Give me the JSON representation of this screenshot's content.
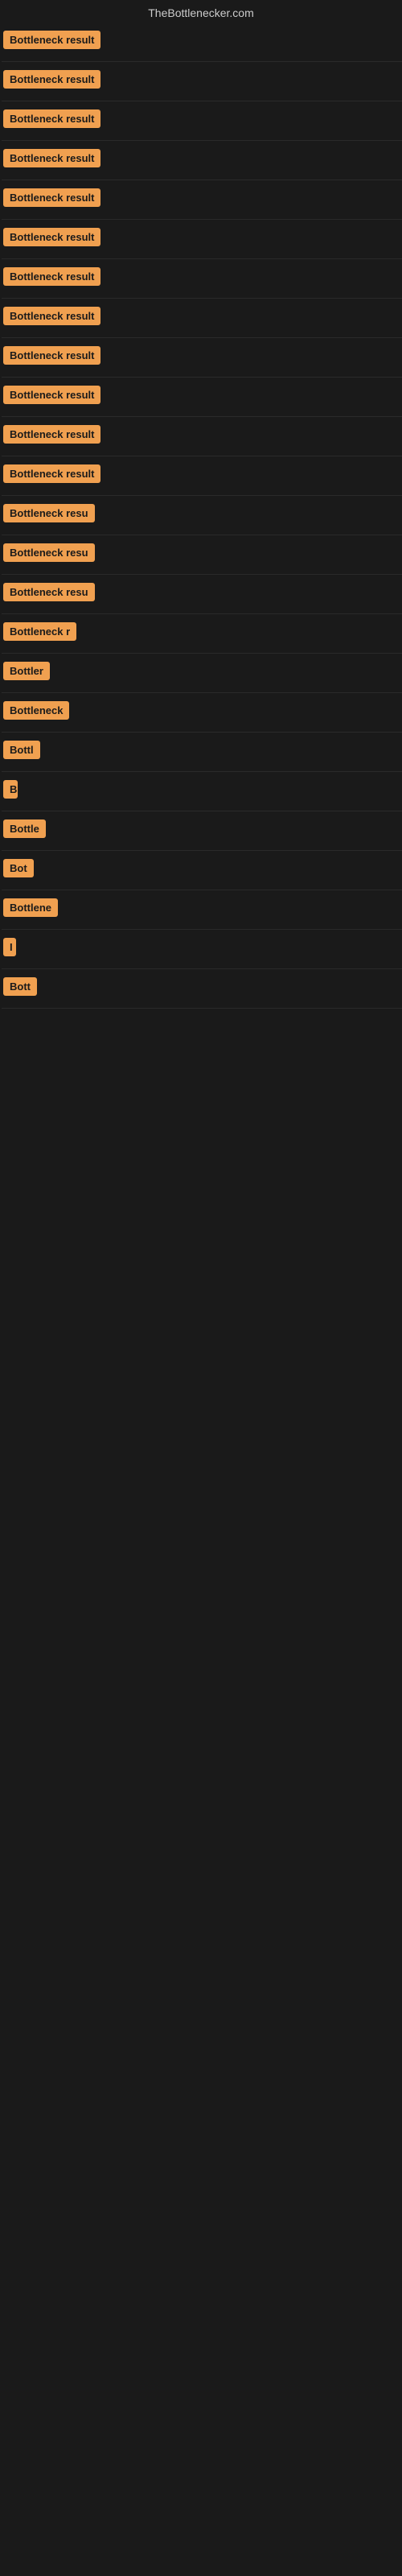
{
  "site": {
    "title": "TheBottlenecker.com"
  },
  "rows": [
    {
      "label": "Bottleneck result",
      "width": 155
    },
    {
      "label": "Bottleneck result",
      "width": 155
    },
    {
      "label": "Bottleneck result",
      "width": 155
    },
    {
      "label": "Bottleneck result",
      "width": 155
    },
    {
      "label": "Bottleneck result",
      "width": 155
    },
    {
      "label": "Bottleneck result",
      "width": 155
    },
    {
      "label": "Bottleneck result",
      "width": 155
    },
    {
      "label": "Bottleneck result",
      "width": 155
    },
    {
      "label": "Bottleneck result",
      "width": 152
    },
    {
      "label": "Bottleneck result",
      "width": 152
    },
    {
      "label": "Bottleneck result",
      "width": 152
    },
    {
      "label": "Bottleneck result",
      "width": 152
    },
    {
      "label": "Bottleneck resu",
      "width": 130
    },
    {
      "label": "Bottleneck resu",
      "width": 128
    },
    {
      "label": "Bottleneck resu",
      "width": 125
    },
    {
      "label": "Bottleneck r",
      "width": 105
    },
    {
      "label": "Bottler",
      "width": 65
    },
    {
      "label": "Bottleneck",
      "width": 90
    },
    {
      "label": "Bottl",
      "width": 55
    },
    {
      "label": "B",
      "width": 18
    },
    {
      "label": "Bottle",
      "width": 60
    },
    {
      "label": "Bot",
      "width": 38
    },
    {
      "label": "Bottlene",
      "width": 80
    },
    {
      "label": "I",
      "width": 10
    },
    {
      "label": "Bott",
      "width": 48
    }
  ]
}
